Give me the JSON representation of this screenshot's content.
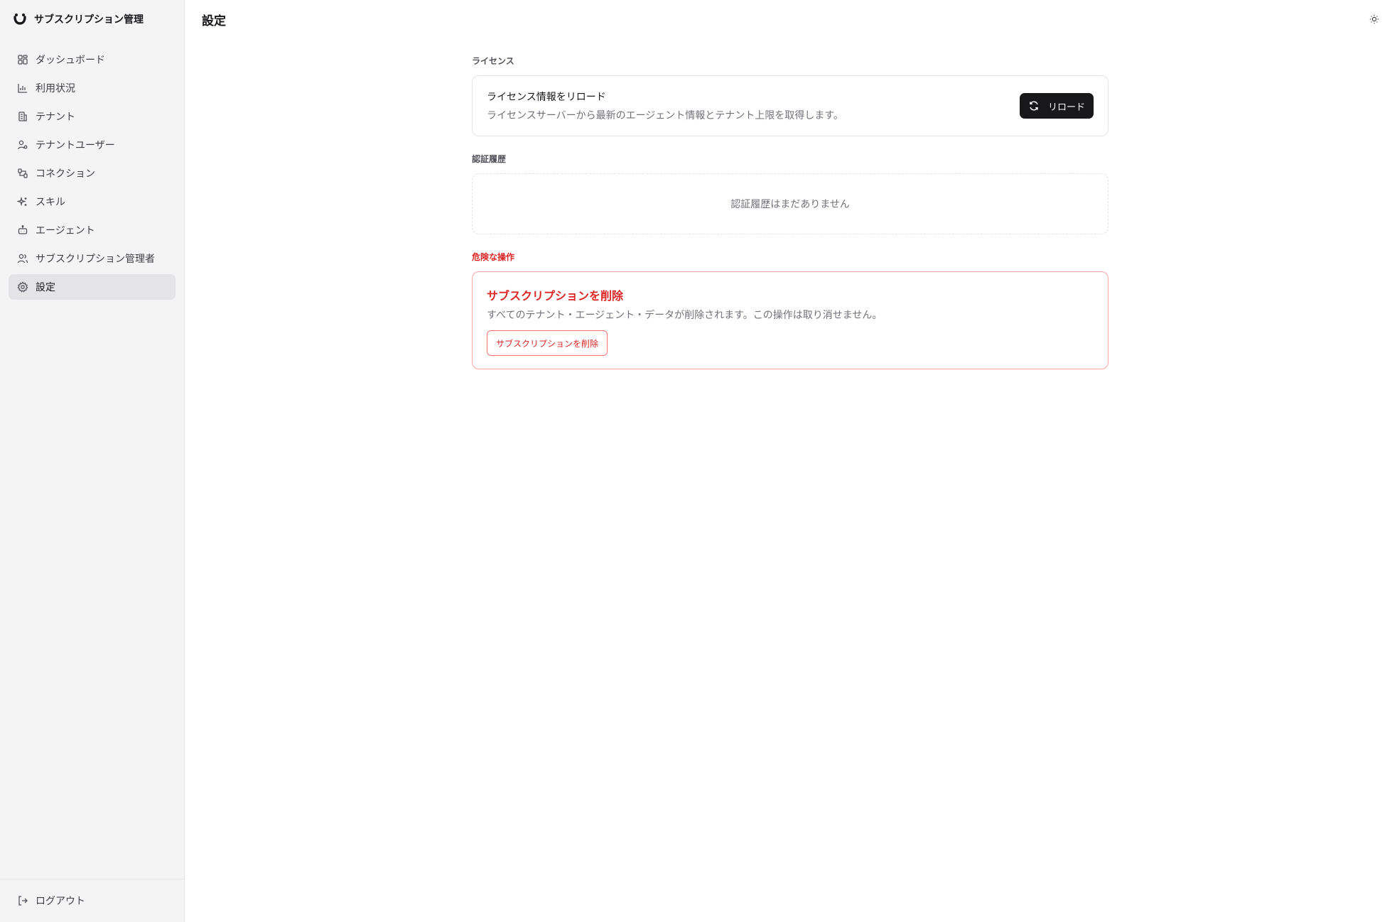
{
  "sidebar": {
    "brand": {
      "title": "サブスクリプション管理",
      "icon": "brand-logo-icon"
    },
    "items": [
      {
        "label": "ダッシュボード",
        "icon": "dashboard-icon",
        "active": false
      },
      {
        "label": "利用状況",
        "icon": "bar-chart-icon",
        "active": false
      },
      {
        "label": "テナント",
        "icon": "building-icon",
        "active": false
      },
      {
        "label": "テナントユーザー",
        "icon": "user-settings-icon",
        "active": false
      },
      {
        "label": "コネクション",
        "icon": "connection-icon",
        "active": false
      },
      {
        "label": "スキル",
        "icon": "sparkles-icon",
        "active": false
      },
      {
        "label": "エージェント",
        "icon": "bot-icon",
        "active": false
      },
      {
        "label": "サブスクリプション管理者",
        "icon": "users-icon",
        "active": false
      },
      {
        "label": "設定",
        "icon": "gear-icon",
        "active": true
      }
    ],
    "logout": {
      "label": "ログアウト",
      "icon": "logout-icon"
    }
  },
  "header": {
    "title": "設定",
    "theme_icon": "sun-icon"
  },
  "license": {
    "section_label": "ライセンス",
    "title": "ライセンス情報をリロード",
    "description": "ライセンスサーバーから最新のエージェント情報とテナント上限を取得します。",
    "button_label": "リロード",
    "button_icon": "refresh-icon"
  },
  "auth_history": {
    "section_label": "認証履歴",
    "empty_text": "認証履歴はまだありません"
  },
  "danger": {
    "section_label": "危険な操作",
    "title": "サブスクリプションを削除",
    "description": "すべてのテナント・エージェント・データが削除されます。この操作は取り消せません。",
    "button_label": "サブスクリプションを削除"
  },
  "colors": {
    "accent_dark": "#18181b",
    "danger": "#dc2626",
    "sidebar_bg": "#f4f4f5",
    "active_item_bg": "#e4e4e7"
  }
}
